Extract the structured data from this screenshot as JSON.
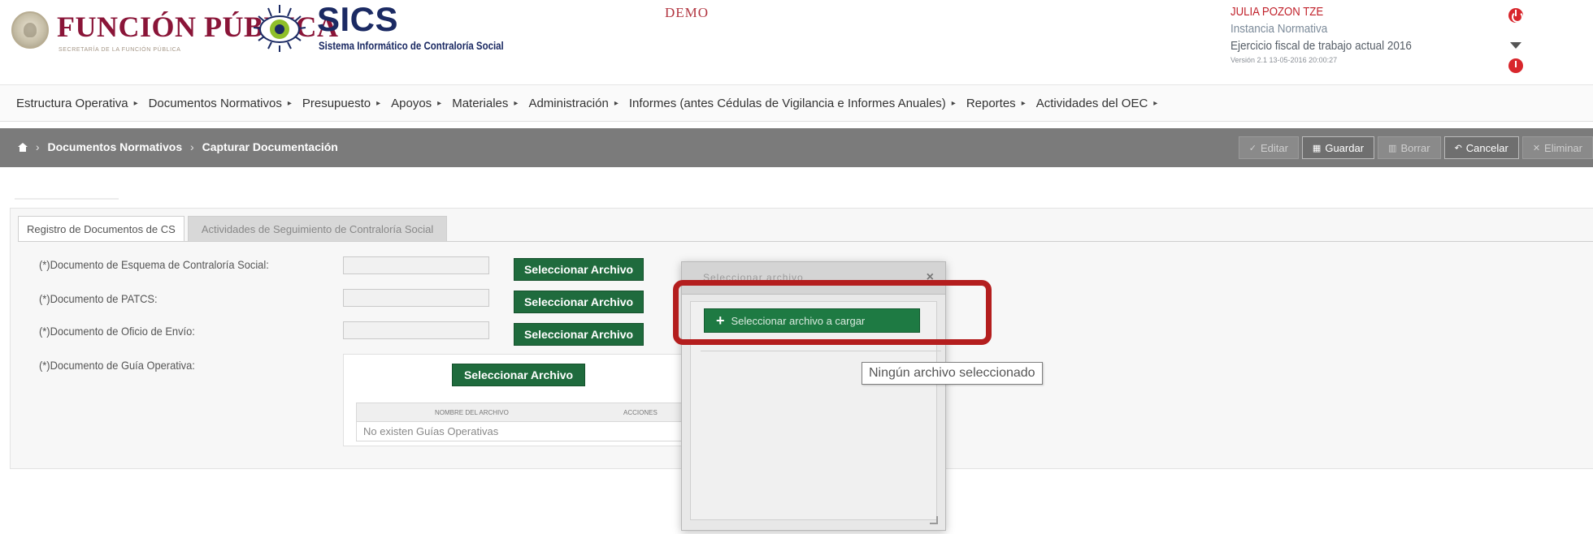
{
  "header": {
    "brand_title": "FUNCIÓN PÚBLICA",
    "brand_subtitle": "SECRETARÍA DE LA FUNCIÓN PÚBLICA",
    "app_title": "SICS",
    "app_subtitle": "Sistema Informático de Contraloría Social",
    "environment": "DEMO",
    "user": {
      "name": "JULIA POZON TZE",
      "instance": "Instancia Normativa",
      "fiscal_year": "Ejercicio fiscal de trabajo actual 2016",
      "version": "Versión 2.1   13-05-2016 20:00:27"
    },
    "colors": {
      "brand": "#8a1538",
      "app": "#1b2a63",
      "alert": "#d8262c"
    }
  },
  "menu": [
    {
      "label": "Estructura Operativa"
    },
    {
      "label": "Documentos Normativos"
    },
    {
      "label": "Presupuesto"
    },
    {
      "label": "Apoyos"
    },
    {
      "label": "Materiales"
    },
    {
      "label": "Administración"
    },
    {
      "label": "Informes (antes Cédulas de Vigilancia e Informes Anuales)"
    },
    {
      "label": "Reportes"
    },
    {
      "label": "Actividades del OEC"
    }
  ],
  "breadcrumb": {
    "items": [
      "Documentos Normativos",
      "Capturar Documentación"
    ]
  },
  "actions": {
    "edit": "Editar",
    "save": "Guardar",
    "delete": "Borrar",
    "cancel": "Cancelar",
    "more": "Eliminar"
  },
  "tabs": [
    {
      "label": "Registro de Documentos de CS",
      "active": true
    },
    {
      "label": "Actividades de Seguimiento de Contraloría Social",
      "active": false
    }
  ],
  "form": {
    "esquema_label": "(*)Documento de Esquema de Contraloría Social:",
    "patcs_label": "(*)Documento de PATCS:",
    "oficio_label": "(*)Documento de Oficio de Envío:",
    "guia_label": "(*)Documento de Guía Operativa:",
    "select_file": "Seleccionar Archivo",
    "guia_table": {
      "col_name": "NOMBRE DEL ARCHIVO",
      "col_actions": "ACCIONES",
      "empty": "No existen Guías Operativas"
    }
  },
  "modal": {
    "title": "Seleccionar archivo",
    "upload_button": "Seleccionar archivo a cargar",
    "tooltip": "Ningún archivo seleccionado"
  }
}
